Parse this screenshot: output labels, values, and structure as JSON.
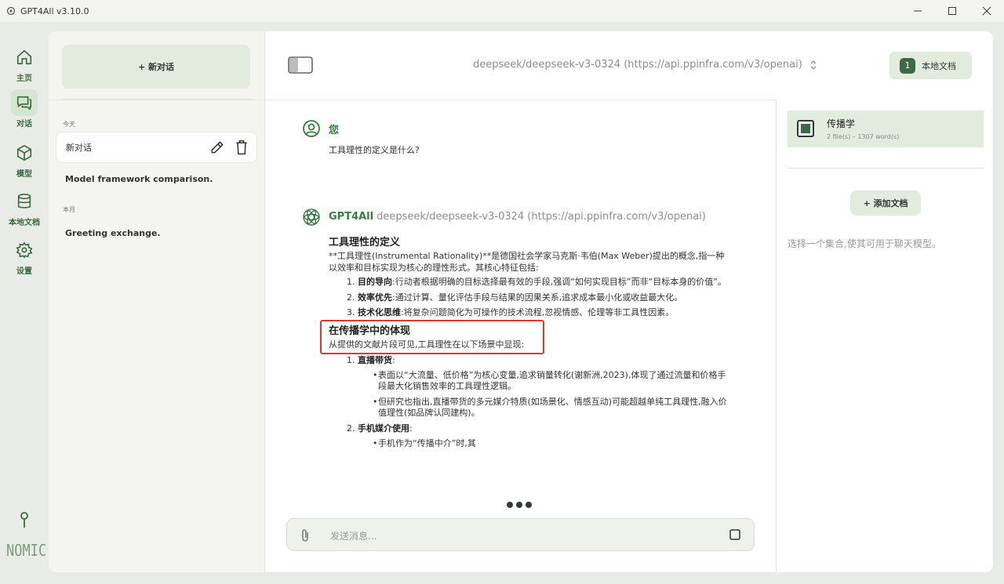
{
  "window": {
    "title": "GPT4All v3.10.0"
  },
  "nav": {
    "items": [
      {
        "label": "主页",
        "icon": "home-icon"
      },
      {
        "label": "对话",
        "icon": "chat-icon"
      },
      {
        "label": "模型",
        "icon": "cube-icon"
      },
      {
        "label": "本地文档",
        "icon": "database-icon"
      },
      {
        "label": "设置",
        "icon": "gear-icon"
      }
    ],
    "logo": "NOMIC"
  },
  "chatlist": {
    "new_chat_label": "+ 新对话",
    "sections": [
      {
        "label": "今天",
        "items": [
          "新对话",
          "Model framework comparison."
        ]
      },
      {
        "label": "本月",
        "items": [
          "Greeting exchange."
        ]
      }
    ]
  },
  "header": {
    "model": "deepseek/deepseek-v3-0324 (https://api.ppinfra.com/v3/openai)",
    "local_docs_label": "本地文档",
    "local_docs_count": "1"
  },
  "conversation": {
    "user": {
      "name": "您",
      "text": "工具理性的定义是什么?"
    },
    "assistant": {
      "name": "GPT4All",
      "model": "deepseek/deepseek-v3-0324 (https://api.ppinfra.com/v3/openai)",
      "heading1": "工具理性的定义",
      "para1": "**工具理性(Instrumental Rationality)**是德国社会学家马克斯·韦伯(Max Weber)提出的概念,指一种以效率和目标实现为核心的理性形式。其核心特征包括:",
      "list1": [
        {
          "num": "1.",
          "bold": "目的导向",
          "text": ":行动者根据明确的目标选择最有效的手段,强调“如何实现目标”而非“目标本身的价值”。"
        },
        {
          "num": "2.",
          "bold": "效率优先",
          "text": ":通过计算、量化评估手段与结果的因果关系,追求成本最小化或收益最大化。"
        },
        {
          "num": "3.",
          "bold": "技术化思维",
          "text": ":将复杂问题简化为可操作的技术流程,忽视情感、伦理等非工具性因素。"
        }
      ],
      "heading2": "在传播学中的体现",
      "para2": "从提供的文献片段可见,工具理性在以下场景中显现:",
      "list2": [
        {
          "num": "1.",
          "bold": "直播带货",
          "text": ":"
        },
        {
          "num": "2.",
          "bold": "手机媒介使用",
          "text": ":"
        }
      ],
      "bullets1": [
        "表面以“大流量、低价格”为核心变量,追求销量转化(谢新洲,2023),体现了通过流量和价格手段最大化销售效率的工具理性逻辑。",
        "但研究也指出,直播带货的多元媒介特质(如场景化、情感互动)可能超越单纯工具理性,融入价值理性(如品牌认同建构)。"
      ],
      "bullets2": [
        "手机作为“传播中介”时,其"
      ]
    }
  },
  "input": {
    "placeholder": "发送消息..."
  },
  "docs": {
    "collection_name": "传播学",
    "collection_meta": "2 file(s) – 1307 word(s)",
    "add_label": "+ 添加文档",
    "hint": "选择一个集合,使其可用于聊天模型。"
  }
}
